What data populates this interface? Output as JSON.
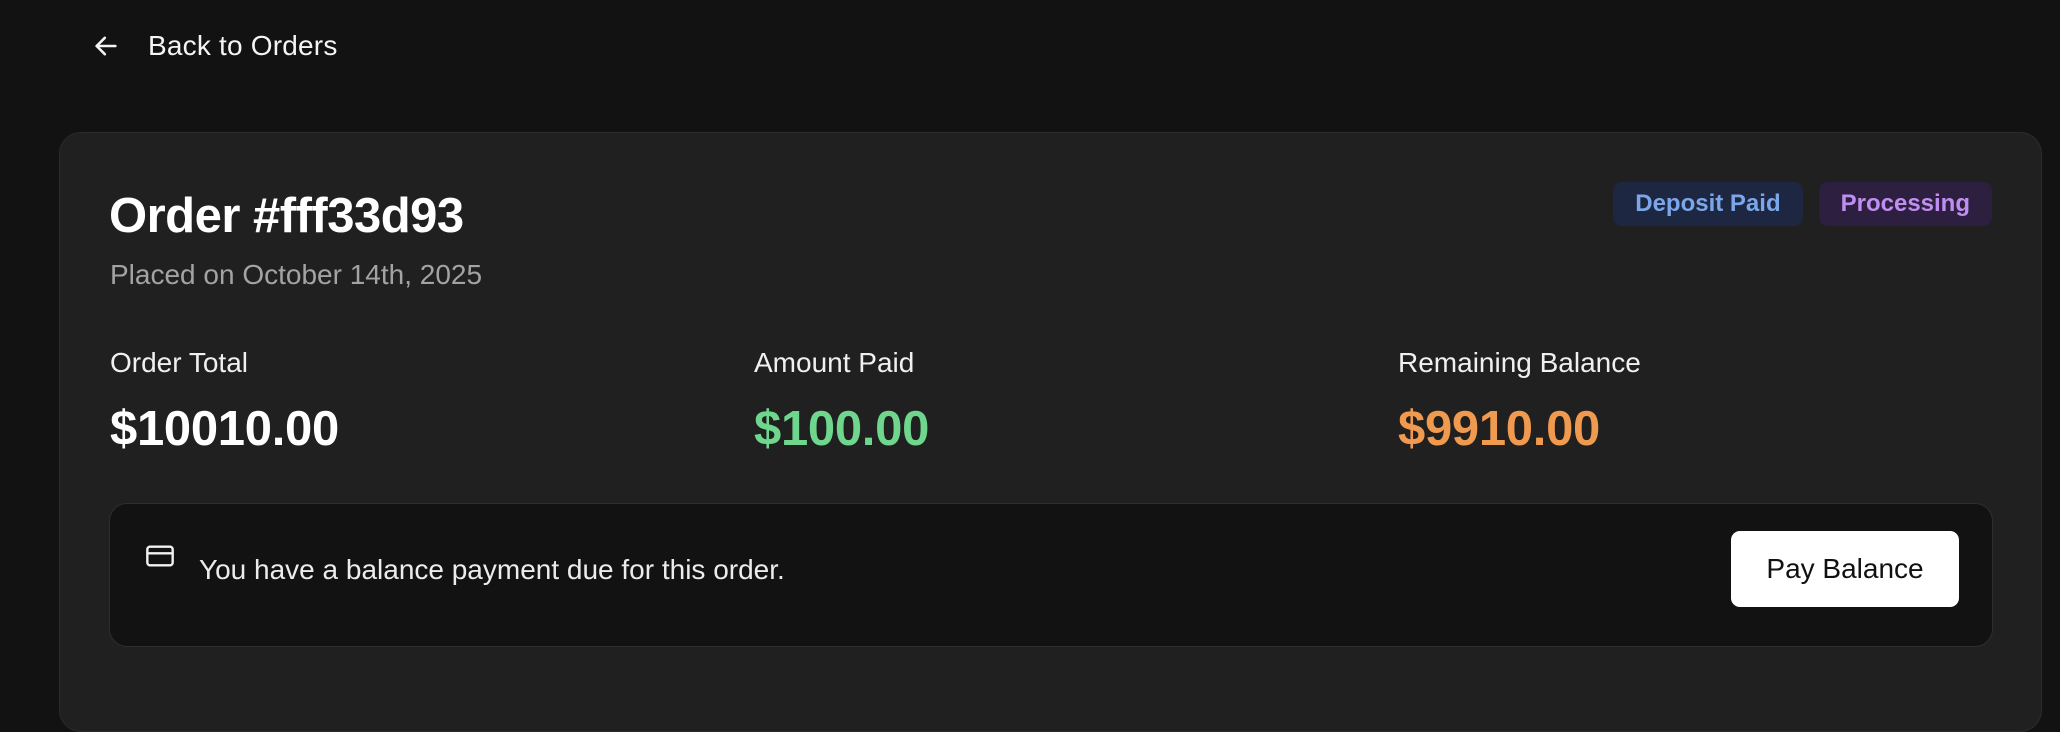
{
  "nav": {
    "back_label": "Back to Orders",
    "back_icon": "arrow-left-icon"
  },
  "order": {
    "title": "Order #fff33d93",
    "placed_on": "Placed on October 14th, 2025",
    "badges": [
      {
        "label": "Deposit Paid",
        "color": "#7ba7ea",
        "background": "#1d2742"
      },
      {
        "label": "Processing",
        "color": "#c08ef0",
        "background": "#2d1f40"
      }
    ]
  },
  "stats": {
    "total": {
      "label": "Order Total",
      "value": "$10010.00",
      "color": "#ffffff"
    },
    "paid": {
      "label": "Amount Paid",
      "value": "$100.00",
      "color": "#6fd68e"
    },
    "remaining": {
      "label": "Remaining Balance",
      "value": "$9910.00",
      "color": "#f09a50"
    }
  },
  "notice": {
    "icon": "credit-card-icon",
    "text": "You have a balance payment due for this order.",
    "button_label": "Pay Balance"
  },
  "colors": {
    "page_background": "#121212",
    "card_background": "#202020",
    "notice_background": "#121212"
  }
}
